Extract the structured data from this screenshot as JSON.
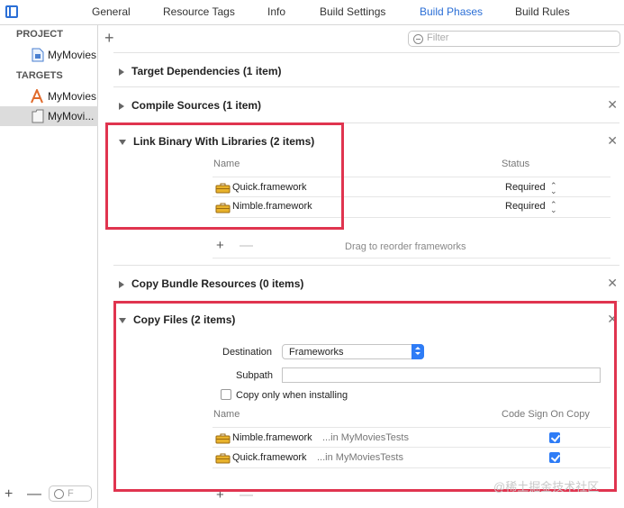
{
  "tabs": [
    "General",
    "Resource Tags",
    "Info",
    "Build Settings",
    "Build Phases",
    "Build Rules"
  ],
  "active_tab": "Build Phases",
  "sidebar": {
    "project_header": "PROJECT",
    "project_item": "MyMovies",
    "targets_header": "TARGETS",
    "target_app": "MyMovies",
    "target_tests": "MyMovi...",
    "filter_placeholder": "F"
  },
  "filter": {
    "placeholder": "Filter"
  },
  "phases": {
    "target_deps": "Target Dependencies (1 item)",
    "compile": "Compile Sources (1 item)",
    "link": {
      "title": "Link Binary With Libraries (2 items)",
      "col_name": "Name",
      "col_status": "Status",
      "rows": [
        {
          "name": "Quick.framework",
          "status": "Required"
        },
        {
          "name": "Nimble.framework",
          "status": "Required"
        }
      ],
      "hint": "Drag to reorder frameworks"
    },
    "copy_bundle": "Copy Bundle Resources (0 items)",
    "copy_files": {
      "title": "Copy Files (2 items)",
      "destination_label": "Destination",
      "destination_value": "Frameworks",
      "subpath_label": "Subpath",
      "subpath_value": "",
      "copy_only_label": "Copy only when installing",
      "col_name": "Name",
      "col_codesign": "Code Sign On Copy",
      "rows": [
        {
          "name": "Nimble.framework",
          "path": "...in MyMoviesTests",
          "code_sign": true
        },
        {
          "name": "Quick.framework",
          "path": "...in MyMoviesTests",
          "code_sign": true
        }
      ]
    }
  },
  "watermark": "@稀土掘金技术社区",
  "colors": {
    "accent": "#2b6fd6",
    "highlight_box": "#e0344f",
    "toggle_blue": "#2e7cf6"
  }
}
